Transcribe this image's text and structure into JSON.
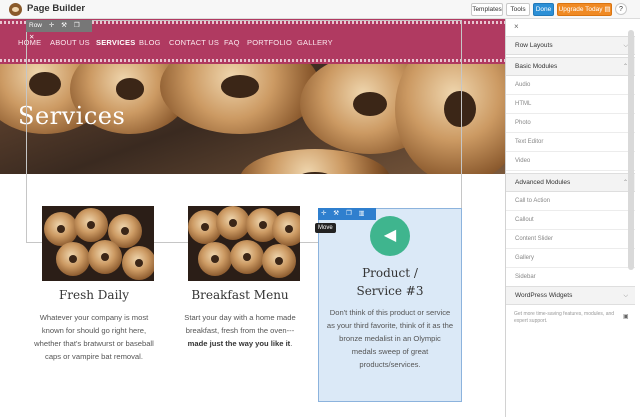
{
  "app": {
    "title": "Page Builder"
  },
  "toolbar": {
    "templates": "Templates",
    "tools": "Tools",
    "done": "Done",
    "upgrade": "Upgrade Today",
    "upgrade_icon": "cart-icon",
    "help": "?"
  },
  "nav": {
    "items": [
      "HOME",
      "ABOUT US",
      "SERVICES",
      "BLOG",
      "CONTACT US",
      "FAQ",
      "PORTFOLIO",
      "GALLERY"
    ],
    "active": "SERVICES"
  },
  "hero": {
    "title": "Services"
  },
  "row_toolbar": {
    "label": "Row"
  },
  "module_toolbar": {
    "tooltip": "Move"
  },
  "columns": [
    {
      "title": "Fresh Daily",
      "text": "Whatever your company is most known for should go right here, whether that's bratwurst or baseball caps or vampire bat removal."
    },
    {
      "title": "Breakfast Menu",
      "text_before": "Start your day with a home made breakfast, fresh from the oven---",
      "text_bold": "made just the way you like it",
      "text_after": "."
    },
    {
      "title_line1": "Product /",
      "title_line2": "Service #3",
      "text": "Don't think of this product or service as your third favorite, think of it as the bronze medalist in an Olympic medals sweep of great products/services.",
      "icon": "megaphone-icon"
    }
  ],
  "panel": {
    "close": "×",
    "sections": {
      "row_layouts": "Row Layouts",
      "basic_modules": "Basic Modules",
      "advanced_modules": "Advanced Modules",
      "wordpress_widgets": "WordPress Widgets"
    },
    "basic_items": [
      "Audio",
      "HTML",
      "Photo",
      "Text Editor",
      "Video"
    ],
    "advanced_items": [
      "Call to Action",
      "Callout",
      "Content Slider",
      "Gallery",
      "Sidebar"
    ],
    "promo": "Get more time-saving features, modules, and expert support."
  },
  "colors": {
    "nav_bg": "#b03a61",
    "done_button": "#2b8fd6",
    "upgrade_button": "#f08a24",
    "selected_module_bg": "#dbe9f7",
    "cta_icon_bg": "#3fb58e"
  }
}
